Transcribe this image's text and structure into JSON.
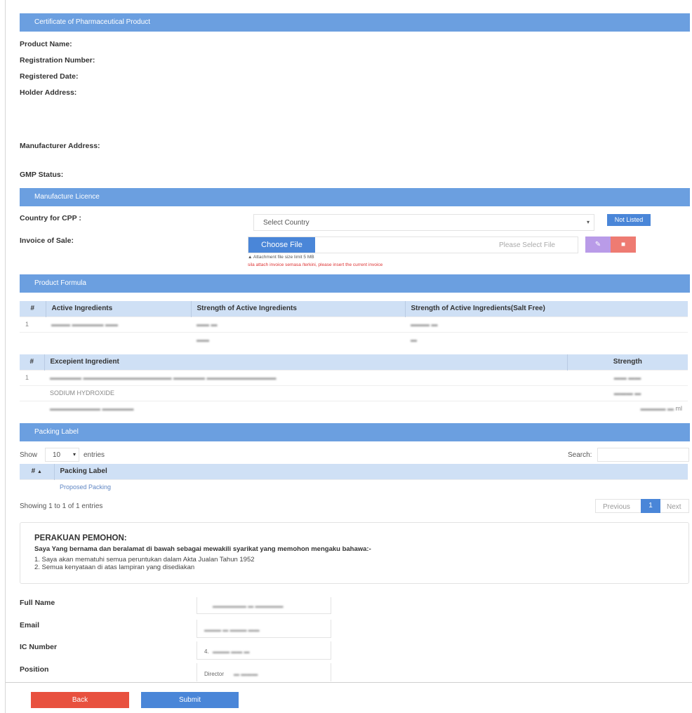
{
  "sections": {
    "cpp": "Certificate of Pharmaceutical Product",
    "licence": "Manufacture Licence",
    "formula": "Product Formula",
    "packing": "Packing Label"
  },
  "cpp_fields": {
    "product_name": "Product Name:",
    "registration_number": "Registration Number:",
    "registered_date": "Registered Date:",
    "holder_address": "Holder Address:",
    "manufacturer_address": "Manufacturer Address:",
    "gmp_status": "GMP Status:"
  },
  "licence": {
    "country_label": "Country for CPP :",
    "country_placeholder": "Select Country",
    "not_listed": "Not Listed",
    "invoice_label": "Invoice of Sale:",
    "choose_file": "Choose File",
    "file_placeholder": "Please Select File",
    "attachment_note": "Attachment file size limit 5 MB",
    "invoice_warning": "sila attach invoice semasa /terkini, please insert the current invoice"
  },
  "active_table": {
    "headers": [
      "#",
      "Active Ingredients",
      "Strength of Active Ingredients",
      "Strength of Active Ingredients(Salt Free)"
    ],
    "rows": [
      [
        "1",
        "",
        "",
        ""
      ],
      [
        "",
        "",
        "",
        ""
      ]
    ]
  },
  "excipient_table": {
    "headers": [
      "#",
      "Excepient Ingredient",
      "Strength"
    ],
    "rows": [
      [
        "1",
        "",
        ""
      ],
      [
        "",
        "SODIUM HYDROXIDE",
        ""
      ],
      [
        "",
        "",
        "ml"
      ]
    ]
  },
  "packing": {
    "show": "Show",
    "page_size": "10",
    "entries": "entries",
    "search": "Search:",
    "headers": [
      "#",
      "Packing Label"
    ],
    "row_text": "Proposed Packing",
    "showing": "Showing 1 to 1 of 1 entries",
    "previous": "Previous",
    "page": "1",
    "next": "Next"
  },
  "declaration": {
    "title": "PERAKUAN PEMOHON:",
    "subtitle": "Saya Yang bernama dan beralamat di bawah sebagai mewakili syarikat yang memohon mengaku bahawa:-",
    "item1": "1. Saya akan mematuhi semua peruntukan dalam Akta Jualan Tahun 1952",
    "item2": "2. Semua kenyataan di atas lampiran yang disediakan"
  },
  "applicant": {
    "full_name_label": "Full Name",
    "email_label": "Email",
    "ic_label": "IC Number",
    "position_label": "Position",
    "ic_value": "4.",
    "position_value": "Director"
  },
  "actions": {
    "back": "Back",
    "submit": "Submit"
  },
  "colors": {
    "section": "#6b9fe0",
    "primary": "#4a86d8",
    "danger": "#e8513f",
    "edit": "#b99be8",
    "delete": "#ee7b72"
  }
}
